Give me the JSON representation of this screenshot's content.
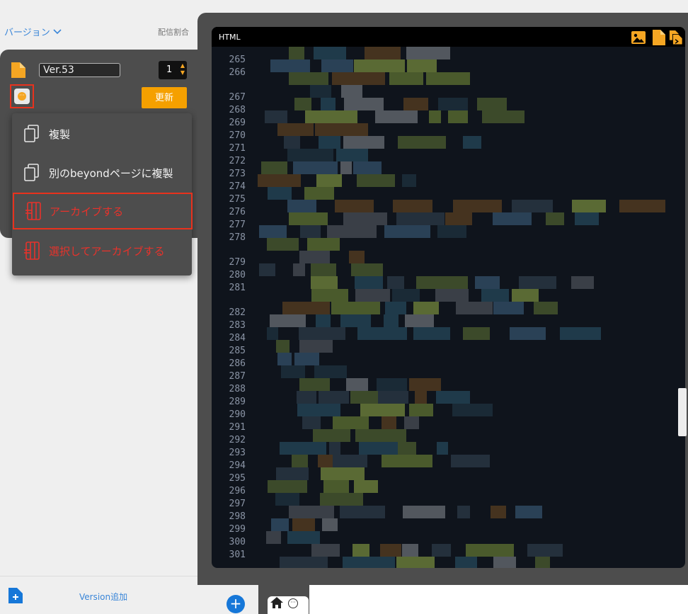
{
  "left_panel": {
    "version_header": "バージョン",
    "ratio_label": "配信割合",
    "version_name": "Ver.53",
    "ratio_value": "1",
    "update_button": "更新",
    "add_version_label": "Version追加"
  },
  "context_menu": {
    "items": [
      {
        "label": "複製"
      },
      {
        "label": "別のbeyondページに複製"
      },
      {
        "label": "アーカイブする"
      },
      {
        "label": "選択してアーカイブする"
      }
    ]
  },
  "editor": {
    "title": "HTML",
    "line_numbers": [
      "265",
      "266",
      "267",
      "268",
      "269",
      "270",
      "271",
      "272",
      "273",
      "274",
      "275",
      "276",
      "277",
      "278",
      "279",
      "280",
      "281",
      "282",
      "283",
      "284",
      "285",
      "286",
      "287",
      "288",
      "289",
      "290",
      "291",
      "292",
      "293",
      "294",
      "295",
      "296",
      "297",
      "298",
      "299",
      "300",
      "301"
    ]
  },
  "colors": {
    "accent": "#f5a623",
    "danger": "#e8321d",
    "link": "#3a86d8",
    "editor_bg": "#0f141c"
  }
}
